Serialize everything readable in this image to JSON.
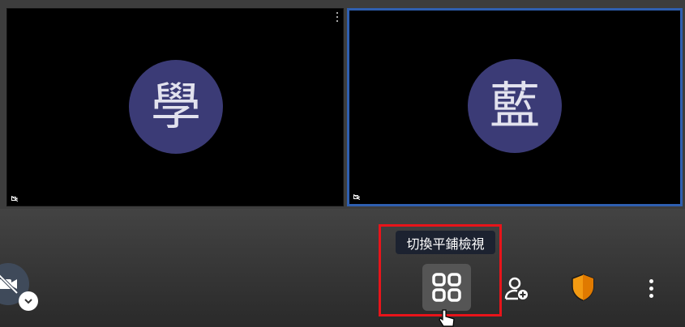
{
  "participants": [
    {
      "initial": "學",
      "avatar_color": "#3b3b76"
    },
    {
      "initial": "藍",
      "avatar_color": "#3b3b76",
      "active_speaker_border": "#2f5fb0"
    }
  ],
  "toolbar": {
    "tooltip": "切換平鋪檢視",
    "buttons": [
      "camera-off-icon",
      "chevron-down-icon",
      "tile-view-icon",
      "invite-person-icon",
      "security-shield-icon",
      "more-options-icon"
    ]
  },
  "highlight_color": "#e8141a"
}
